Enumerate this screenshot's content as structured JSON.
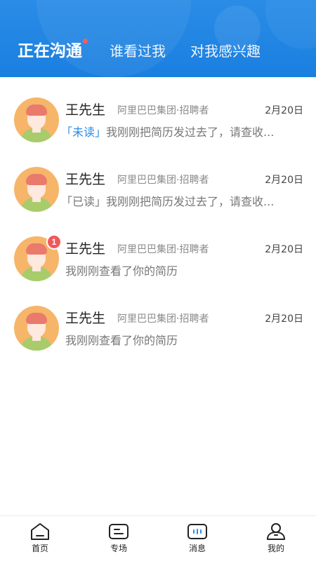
{
  "header": {
    "tabs": [
      {
        "label": "正在沟通",
        "active": true,
        "has_dot": true
      },
      {
        "label": "谁看过我",
        "active": false
      },
      {
        "label": "对我感兴趣",
        "active": false
      }
    ],
    "accent_color": "#1a7fe0"
  },
  "conversations": [
    {
      "name": "王先生",
      "company": "阿里巴巴集团·招聘者",
      "date": "2月20日",
      "status": "「未读」",
      "status_type": "unread",
      "message": "我刚刚把简历发过去了，请查收...",
      "badge": ""
    },
    {
      "name": "王先生",
      "company": "阿里巴巴集团·招聘者",
      "date": "2月20日",
      "status": "「已读」",
      "status_type": "read",
      "message": "我刚刚把简历发过去了，请查收...",
      "badge": ""
    },
    {
      "name": "王先生",
      "company": "阿里巴巴集团·招聘者",
      "date": "2月20日",
      "status": "",
      "status_type": "",
      "message": "我刚刚查看了你的简历",
      "badge": "1"
    },
    {
      "name": "王先生",
      "company": "阿里巴巴集团·招聘者",
      "date": "2月20日",
      "status": "",
      "status_type": "",
      "message": "我刚刚查看了你的简历",
      "badge": ""
    }
  ],
  "bottom_nav": [
    {
      "label": "首页",
      "icon": "home-icon"
    },
    {
      "label": "专场",
      "icon": "special-icon"
    },
    {
      "label": "消息",
      "icon": "message-icon"
    },
    {
      "label": "我的",
      "icon": "profile-icon"
    }
  ]
}
